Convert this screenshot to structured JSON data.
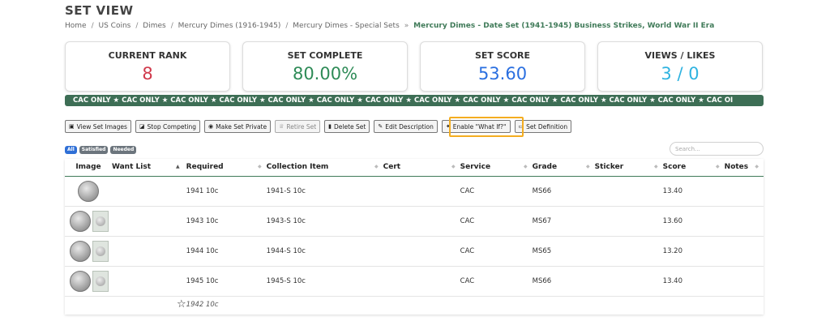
{
  "page": {
    "title": "SET VIEW"
  },
  "breadcrumb": {
    "items": [
      "Home",
      "US Coins",
      "Dimes",
      "Mercury Dimes (1916-1945)",
      "Mercury Dimes - Special Sets"
    ],
    "separator": "/",
    "arrow": "»",
    "current": "Mercury Dimes - Date Set (1941-1945) Business Strikes, World War II Era"
  },
  "stats": [
    {
      "label": "CURRENT RANK",
      "value": "8",
      "color": "#d0394b"
    },
    {
      "label": "SET COMPLETE",
      "value": "80.00%",
      "color": "#2e8b57"
    },
    {
      "label": "SET SCORE",
      "value": "53.60",
      "color": "#2a6fe0"
    },
    {
      "label": "VIEWS / LIKES",
      "value": "3 / 0",
      "color": "#2fb3e0"
    }
  ],
  "cac_banner": "CAC ONLY  ★  CAC ONLY  ★  CAC ONLY  ★  CAC ONLY  ★  CAC ONLY  ★  CAC ONLY  ★  CAC ONLY  ★  CAC ONLY  ★  CAC ONLY  ★  CAC ONLY  ★  CAC ONLY  ★  CAC ONLY  ★  CAC ONLY  ★  CAC OI",
  "toolbar": {
    "view_images": "View Set Images",
    "stop_competing": "Stop Competing",
    "make_private": "Make Set Private",
    "retire_set": "Retire Set",
    "delete_set": "Delete Set",
    "edit_description": "Edit Description",
    "enable_what_if": "Enable \"What If?\"",
    "set_definition": "Set Definition"
  },
  "filters": {
    "all": "All",
    "satisfied": "Satisfied",
    "needed": "Needed"
  },
  "search": {
    "placeholder": "Search..."
  },
  "table": {
    "headers": {
      "image": "Image",
      "want_list": "Want List",
      "required": "Required",
      "collection_item": "Collection Item",
      "cert": "Cert",
      "service": "Service",
      "grade": "Grade",
      "sticker": "Sticker",
      "score": "Score",
      "notes": "Notes"
    },
    "rows": [
      {
        "required": "1941 10c",
        "collection_item": "1941-S 10c",
        "cert": "",
        "service": "CAC",
        "grade": "MS66",
        "sticker": "",
        "score": "13.40",
        "notes": ""
      },
      {
        "required": "1943 10c",
        "collection_item": "1943-S 10c",
        "cert": "",
        "service": "CAC",
        "grade": "MS67",
        "sticker": "",
        "score": "13.60",
        "notes": ""
      },
      {
        "required": "1944 10c",
        "collection_item": "1944-S 10c",
        "cert": "",
        "service": "CAC",
        "grade": "MS65",
        "sticker": "",
        "score": "13.20",
        "notes": ""
      },
      {
        "required": "1945 10c",
        "collection_item": "1945-S 10c",
        "cert": "",
        "service": "CAC",
        "grade": "MS66",
        "sticker": "",
        "score": "13.40",
        "notes": ""
      }
    ],
    "want_row": {
      "required": "1942 10c"
    }
  },
  "icons": {
    "view_images": "image-icon",
    "stop_competing": "chart-icon",
    "make_private": "eye-slash-icon",
    "retire_set": "trophy-icon",
    "delete_set": "trash-icon",
    "edit_description": "edit-icon",
    "enable_what_if": "sparkle-icon",
    "set_definition": "book-icon",
    "want_star": "star-icon"
  }
}
